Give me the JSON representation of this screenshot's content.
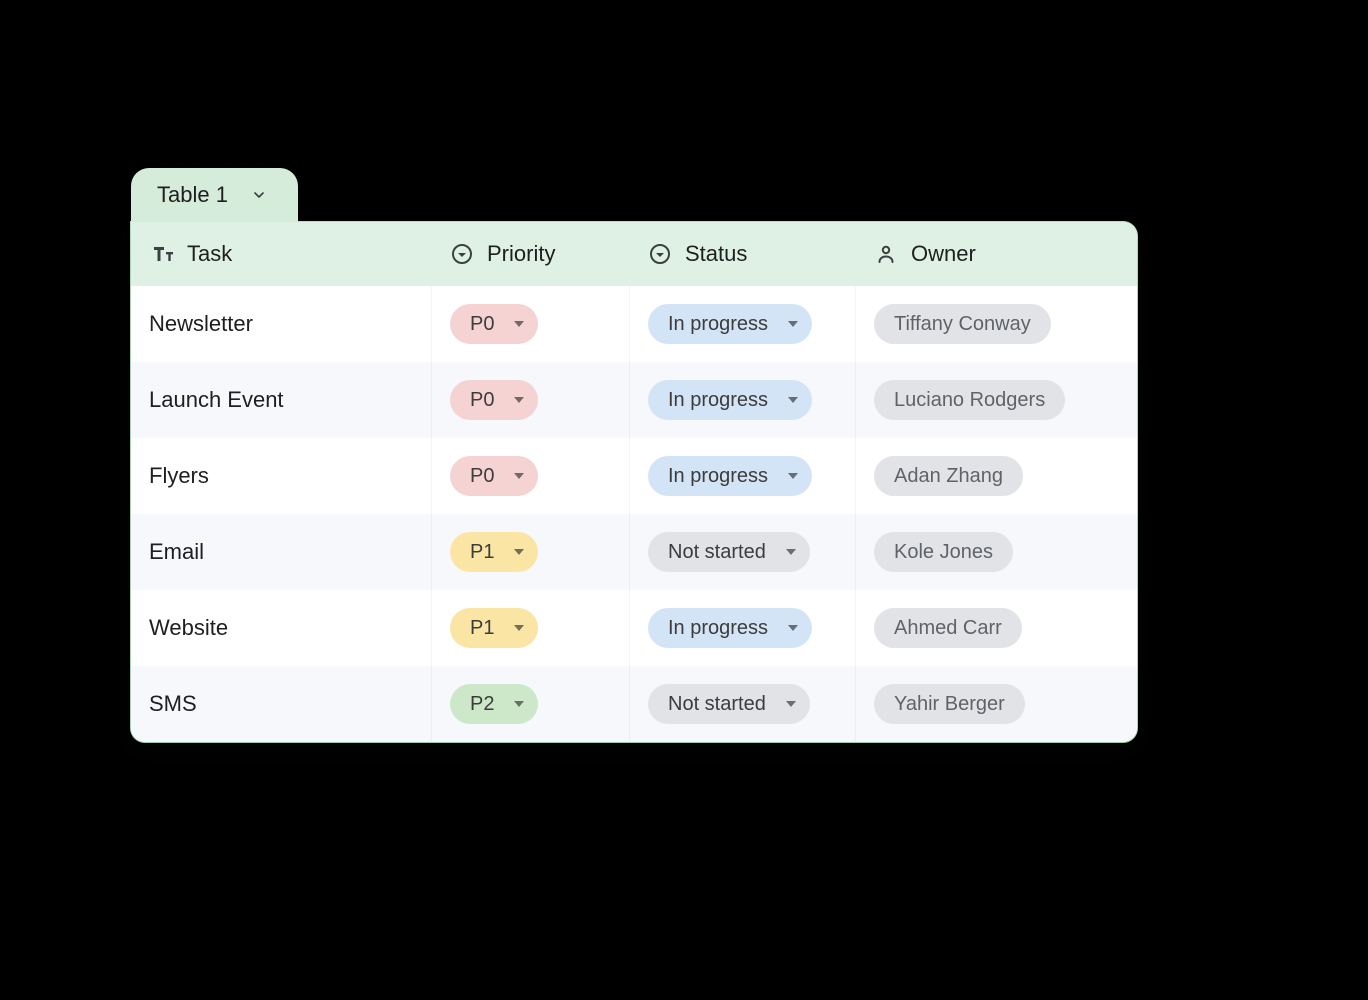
{
  "tab": {
    "label": "Table 1"
  },
  "columns": {
    "task": {
      "label": "Task",
      "icon": "text-icon"
    },
    "priority": {
      "label": "Priority",
      "icon": "dropdown-icon"
    },
    "status": {
      "label": "Status",
      "icon": "dropdown-icon"
    },
    "owner": {
      "label": "Owner",
      "icon": "person-icon"
    }
  },
  "rows": [
    {
      "task": "Newsletter",
      "priority": "P0",
      "status": "In progress",
      "owner": "Tiffany Conway"
    },
    {
      "task": "Launch Event",
      "priority": "P0",
      "status": "In progress",
      "owner": "Luciano Rodgers"
    },
    {
      "task": "Flyers",
      "priority": "P0",
      "status": "In progress",
      "owner": "Adan Zhang"
    },
    {
      "task": "Email",
      "priority": "P1",
      "status": "Not started",
      "owner": "Kole Jones"
    },
    {
      "task": "Website",
      "priority": "P1",
      "status": "In progress",
      "owner": "Ahmed Carr"
    },
    {
      "task": "SMS",
      "priority": "P2",
      "status": "Not started",
      "owner": "Yahir Berger"
    }
  ],
  "colors": {
    "priority": {
      "P0": "#f6d3d3",
      "P1": "#fbe5a4",
      "P2": "#cce8c9"
    },
    "status": {
      "In progress": "#d4e4f7",
      "Not started": "#e2e3e6"
    },
    "owner_chip": "#e2e3e6",
    "header_bg": "#dff1e4",
    "tab_bg": "#d6ecdb"
  }
}
